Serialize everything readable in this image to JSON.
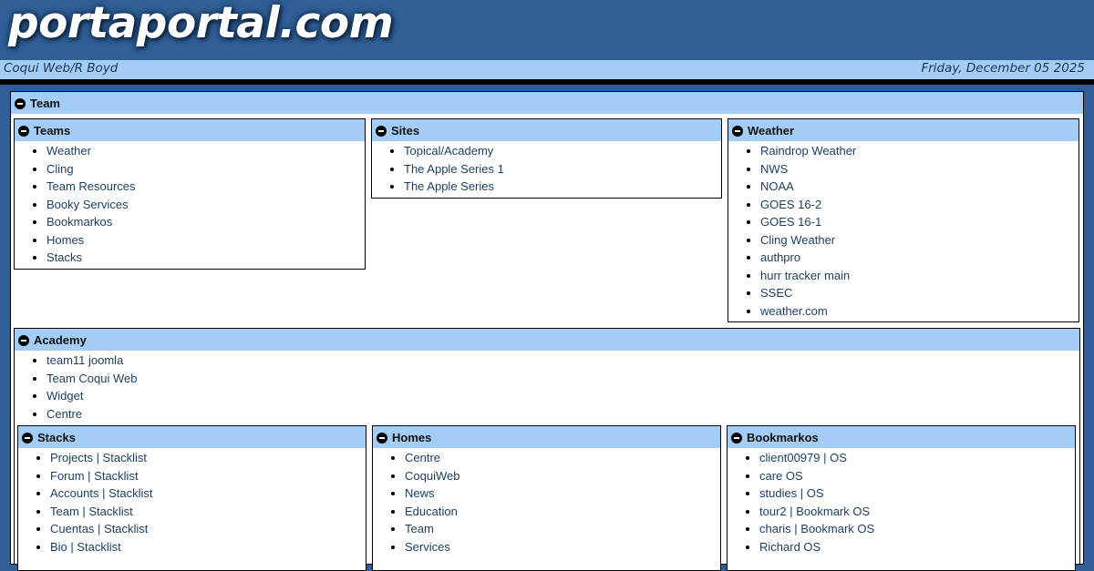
{
  "header": {
    "logo": "portaportal.com"
  },
  "subbar": {
    "breadcrumb": "Coqui Web/R Boyd",
    "date": "Friday, December 05 2025"
  },
  "team": {
    "title": "Team",
    "teams": {
      "title": "Teams",
      "items": [
        "Weather",
        "Cling",
        "Team Resources",
        "Booky Services",
        "Bookmarkos",
        "Homes",
        "Stacks"
      ]
    },
    "sites": {
      "title": "Sites",
      "items": [
        "Topical/Academy",
        "The Apple Series 1",
        "The Apple Series"
      ]
    },
    "weather": {
      "title": "Weather",
      "items": [
        "Raindrop Weather",
        "NWS",
        "NOAA",
        "GOES 16-2",
        "GOES 16-1",
        "Cling Weather",
        "authpro",
        "hurr tracker main",
        "SSEC",
        "weather.com"
      ]
    },
    "academy": {
      "title": "Academy",
      "items": [
        "team11 joomla",
        "Team Coqui Web",
        "Widget",
        "Centre"
      ],
      "stacks": {
        "title": "Stacks",
        "items": [
          "Projects | Stacklist",
          "Forum | Stacklist",
          "Accounts | Stacklist",
          "Team | Stacklist",
          "Cuentas | Stacklist",
          "Bio | Stacklist"
        ]
      },
      "homes": {
        "title": "Homes",
        "items": [
          "Centre",
          "CoquiWeb",
          "News",
          "Education",
          "Team",
          "Services"
        ]
      },
      "bookmarkos": {
        "title": "Bookmarkos",
        "items": [
          "client00979 | OS",
          "care OS",
          "studies | OS",
          "tour2 | Bookmark OS",
          "charis | Bookmark OS",
          "Richard OS"
        ]
      }
    }
  },
  "colors": {
    "banner": "#2f5f96",
    "panel_header": "#a3cdf7",
    "link": "#1c3d5e"
  }
}
